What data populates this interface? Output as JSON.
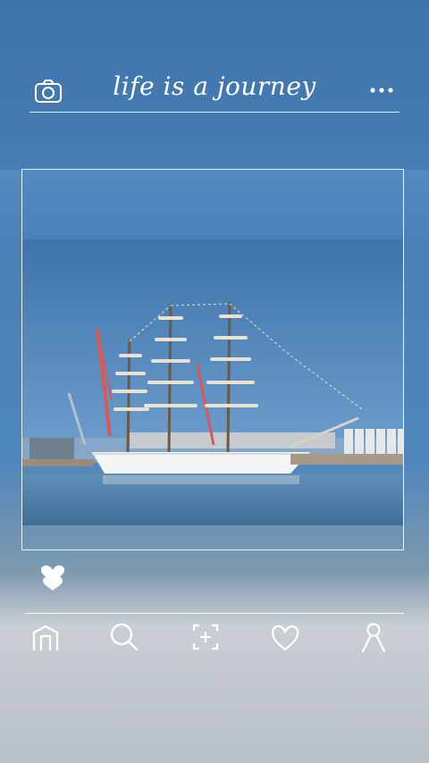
{
  "header": {
    "title": "life is a journey",
    "left_icon": "camera-icon",
    "right_icon": "more-dots-icon"
  },
  "post": {
    "image": "tall-ship-in-harbor",
    "like_icon": "heart-icon"
  },
  "nav": {
    "items": [
      {
        "icon": "home-icon"
      },
      {
        "icon": "search-icon"
      },
      {
        "icon": "add-post-icon"
      },
      {
        "icon": "heart-outline-icon"
      },
      {
        "icon": "profile-icon"
      }
    ]
  },
  "colors": {
    "background": "#4a80b6",
    "foreground": "#ffffff"
  }
}
